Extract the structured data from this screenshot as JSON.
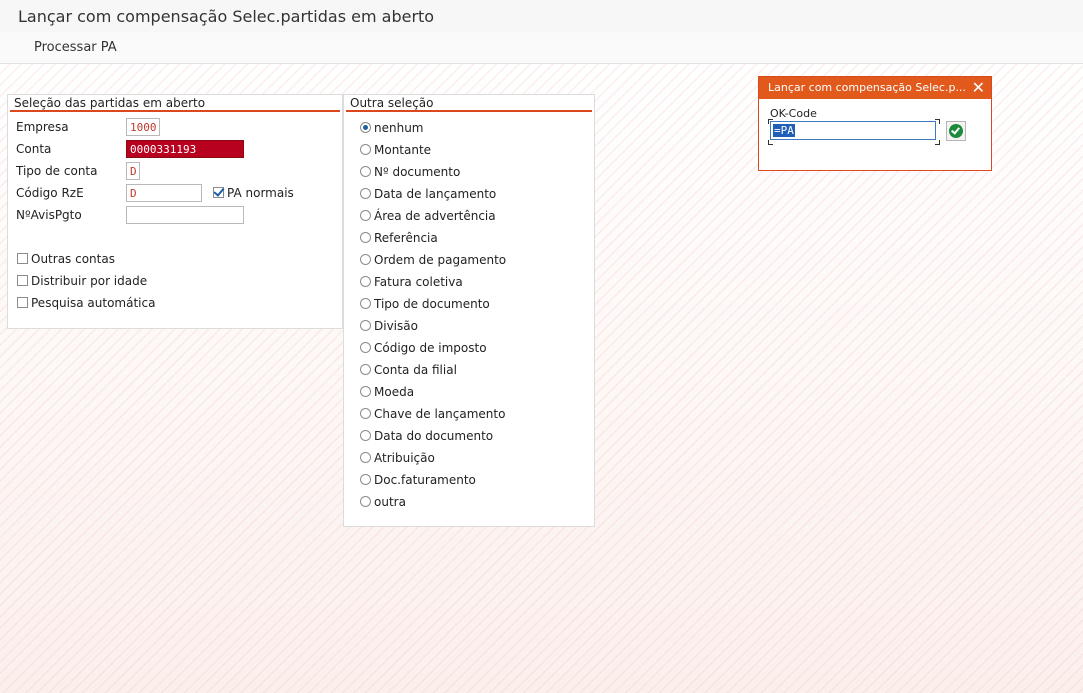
{
  "window": {
    "title": "Lançar com compensação Selec.partidas em aberto"
  },
  "toolbar": {
    "process_label": "Processar PA"
  },
  "left_group": {
    "title": "Seleção das partidas em aberto",
    "fields": {
      "empresa": {
        "label": "Empresa",
        "value": "1000"
      },
      "conta": {
        "label": "Conta",
        "value": "0000331193"
      },
      "tipo_conta": {
        "label": "Tipo de conta",
        "value": "D"
      },
      "codigo_rze": {
        "label": "Código RzE",
        "value": "D"
      },
      "pa_normais": {
        "label": "PA normais",
        "checked": true
      },
      "navispgto": {
        "label": "NºAvisPgto",
        "value": ""
      }
    },
    "checkboxes": [
      {
        "label": "Outras contas",
        "checked": false
      },
      {
        "label": "Distribuir por idade",
        "checked": false
      },
      {
        "label": "Pesquisa automática",
        "checked": false
      }
    ]
  },
  "right_group": {
    "title": "Outra seleção",
    "options": [
      {
        "label": "nenhum",
        "selected": true
      },
      {
        "label": "Montante",
        "selected": false
      },
      {
        "label": "Nº documento",
        "selected": false
      },
      {
        "label": "Data de lançamento",
        "selected": false
      },
      {
        "label": "Área de advertência",
        "selected": false
      },
      {
        "label": "Referência",
        "selected": false
      },
      {
        "label": "Ordem de pagamento",
        "selected": false
      },
      {
        "label": "Fatura coletiva",
        "selected": false
      },
      {
        "label": "Tipo de documento",
        "selected": false
      },
      {
        "label": "Divisão",
        "selected": false
      },
      {
        "label": "Código de imposto",
        "selected": false
      },
      {
        "label": "Conta da filial",
        "selected": false
      },
      {
        "label": "Moeda",
        "selected": false
      },
      {
        "label": "Chave de lançamento",
        "selected": false
      },
      {
        "label": "Data do documento",
        "selected": false
      },
      {
        "label": "Atribuição",
        "selected": false
      },
      {
        "label": "Doc.faturamento",
        "selected": false
      },
      {
        "label": "outra",
        "selected": false
      }
    ]
  },
  "dialog": {
    "title": "Lançar com compensação Selec.p...",
    "okcode_label": "OK-Code",
    "okcode_value": "=PA",
    "close_icon": "close-icon",
    "confirm_icon": "checkmark-icon"
  },
  "colors": {
    "accent": "#e15a1c",
    "selection": "#b8001f",
    "ok_green": "#1d8a3c"
  }
}
